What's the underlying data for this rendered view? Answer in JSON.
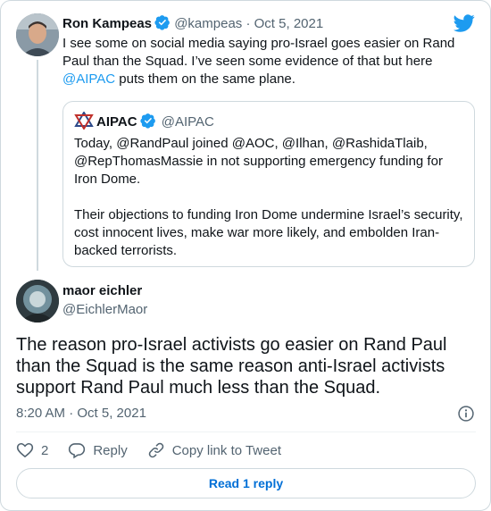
{
  "parent_tweet": {
    "author_name": "Ron Kampeas",
    "author_handle": "@kampeas",
    "separator": "·",
    "date": "Oct 5, 2021",
    "text_before": "I see some on social media saying pro-Israel goes easier on Rand Paul than the Squad. I’ve seen some evidence of that but here ",
    "mention": "@AIPAC",
    "text_after": " puts them on the same plane."
  },
  "quoted_tweet": {
    "author_name": "AIPAC",
    "author_handle": "@AIPAC",
    "paragraph_1": "Today, @RandPaul joined @AOC, @Ilhan, @RashidaTlaib, @RepThomasMassie in not supporting emergency funding for Iron Dome.",
    "paragraph_2": "Their objections to funding Iron Dome undermine Israel’s security, cost innocent lives, make war more likely, and embolden Iran-backed terrorists."
  },
  "main_tweet": {
    "author_name": "maor eichler",
    "author_handle": "@EichlerMaor",
    "text": "The reason pro-Israel activists go easier on Rand Paul than the Squad is the same reason anti-Israel activists support Rand Paul much less than the Squad.",
    "timestamp": "8:20 AM · Oct 5, 2021"
  },
  "actions": {
    "like_count": "2",
    "reply_label": "Reply",
    "copy_link_label": "Copy link to Tweet"
  },
  "read_replies_label": "Read 1 reply",
  "icons": [
    "twitter-logo-icon",
    "verified-badge-icon",
    "info-icon",
    "heart-icon",
    "reply-icon",
    "link-icon"
  ],
  "colors": {
    "accent": "#1d9bf0",
    "text": "#0f1419",
    "secondary": "#536471",
    "border": "#cfd9de",
    "button_text": "#006fd6"
  }
}
